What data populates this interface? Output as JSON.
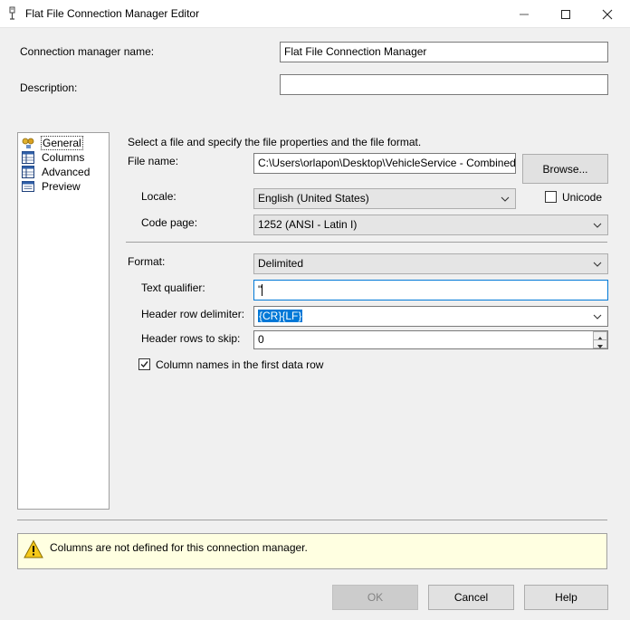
{
  "window": {
    "title": "Flat File Connection Manager Editor",
    "icon": "connection-manager-icon"
  },
  "header": {
    "name_label": "Connection manager name:",
    "name_value": "Flat File Connection Manager",
    "description_label": "Description:",
    "description_value": ""
  },
  "sidebar": {
    "items": [
      {
        "label": "General",
        "icon": "general-icon",
        "selected": true
      },
      {
        "label": "Columns",
        "icon": "columns-icon",
        "selected": false
      },
      {
        "label": "Advanced",
        "icon": "advanced-icon",
        "selected": false
      },
      {
        "label": "Preview",
        "icon": "preview-icon",
        "selected": false
      }
    ]
  },
  "general": {
    "intro": "Select a file and specify the file properties and the file format.",
    "file_name_label": "File name:",
    "file_name_value": "C:\\Users\\orlapon\\Desktop\\VehicleService - Combined",
    "browse_label": "Browse...",
    "locale_label": "Locale:",
    "locale_value": "English (United States)",
    "unicode_label": "Unicode",
    "unicode_checked": false,
    "code_page_label": "Code page:",
    "code_page_value": "1252  (ANSI - Latin I)",
    "format_label": "Format:",
    "format_value": "Delimited",
    "text_qualifier_label": "Text qualifier:",
    "text_qualifier_value": "\"",
    "header_row_delim_label": "Header row delimiter:",
    "header_row_delim_value": "{CR}{LF}",
    "header_rows_skip_label": "Header rows to skip:",
    "header_rows_skip_value": "0",
    "column_names_label": "Column names in the first data row",
    "column_names_checked": true
  },
  "warning": {
    "icon": "warning-icon",
    "text": "Columns are not defined for this connection manager."
  },
  "footer": {
    "ok_label": "OK",
    "cancel_label": "Cancel",
    "help_label": "Help"
  },
  "colors": {
    "selection": "#0078d7",
    "warning_bg": "#ffffe1",
    "focus_border": "#0078d7"
  }
}
